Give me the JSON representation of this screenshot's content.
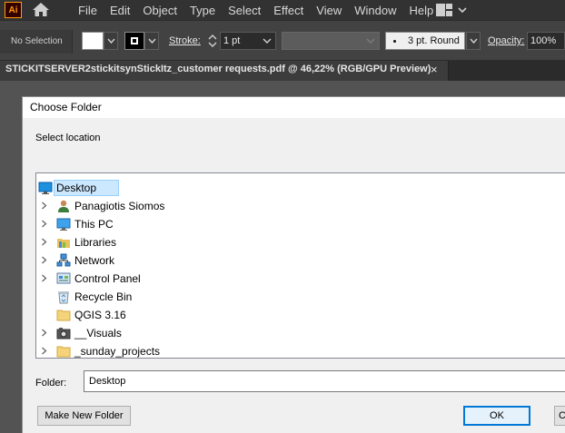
{
  "app": {
    "logo_text": "Ai"
  },
  "menu": [
    "File",
    "Edit",
    "Object",
    "Type",
    "Select",
    "Effect",
    "View",
    "Window",
    "Help"
  ],
  "control_bar": {
    "selection": "No Selection",
    "stroke_label": "Stroke:",
    "stroke_weight": "1 pt",
    "brush": "3 pt. Round",
    "opacity_label": "Opacity:",
    "opacity_value": "100%"
  },
  "document_tab": {
    "title": "STICKITSERVER2stickitsynStickItz_customer requests.pdf @ 46,22% (RGB/GPU Preview)",
    "close": "×"
  },
  "dialog": {
    "title": "Choose Folder",
    "instruction": "Select location",
    "tree": [
      {
        "label": "Desktop",
        "icon": "desktop-icon",
        "expandable": false,
        "selected": true
      },
      {
        "label": "Panagiotis Siomos",
        "icon": "user-icon",
        "expandable": true
      },
      {
        "label": "This PC",
        "icon": "computer-icon",
        "expandable": true
      },
      {
        "label": "Libraries",
        "icon": "libraries-icon",
        "expandable": true
      },
      {
        "label": "Network",
        "icon": "network-icon",
        "expandable": true
      },
      {
        "label": "Control Panel",
        "icon": "control-panel-icon",
        "expandable": true
      },
      {
        "label": "Recycle Bin",
        "icon": "recycle-bin-icon",
        "expandable": false
      },
      {
        "label": "QGIS 3.16",
        "icon": "folder-icon",
        "expandable": false
      },
      {
        "label": "__Visuals",
        "icon": "camera-folder-icon",
        "expandable": true
      },
      {
        "label": "_sunday_projects",
        "icon": "folder-icon",
        "expandable": true
      }
    ],
    "folder_label": "Folder:",
    "folder_value": "Desktop",
    "buttons": {
      "new_folder": "Make New Folder",
      "ok": "OK",
      "cancel": "Ca"
    }
  },
  "colors": {
    "accent": "#0078d7",
    "selection": "#cce8ff",
    "ai_orange": "#ff9a00"
  }
}
